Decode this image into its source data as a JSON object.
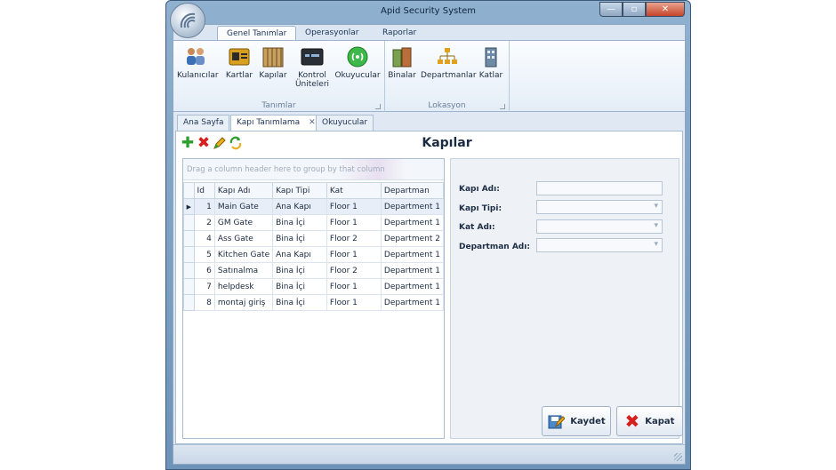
{
  "window": {
    "title": "Apid Security System",
    "min": "—",
    "max": "▫",
    "close": "✕"
  },
  "ribbon": {
    "tabs": [
      "Genel Tanımlar",
      "Operasyonlar",
      "Raporlar"
    ],
    "groups": [
      {
        "label": "Tanımlar",
        "buttons": [
          "Kulanıcılar",
          "Kartlar",
          "Kapılar",
          "Kontrol Üniteleri",
          "Okuyucular"
        ]
      },
      {
        "label": "Lokasyon",
        "buttons": [
          "Binalar",
          "Departmanlar",
          "Katlar"
        ]
      }
    ]
  },
  "doc_tabs": [
    "Ana Sayfa",
    "Kapı Tanımlama",
    "Okuyucular"
  ],
  "page": {
    "title": "Kapılar"
  },
  "grid": {
    "group_hint": "Drag a column header here to group by that column",
    "columns": [
      "Id",
      "Kapı Adı",
      "Kapı Tipi",
      "Kat",
      "Departman"
    ],
    "rows": [
      [
        "1",
        "Main Gate",
        "Ana Kapı",
        "Floor 1",
        "Department 1"
      ],
      [
        "2",
        "GM Gate",
        "Bina İçi",
        "Floor 1",
        "Department 1"
      ],
      [
        "4",
        "Ass Gate",
        "Bina İçi",
        "Floor 2",
        "Department 2"
      ],
      [
        "5",
        "Kitchen Gate",
        "Ana Kapı",
        "Floor 1",
        "Department 1"
      ],
      [
        "6",
        "Satınalma",
        "Bina İçi",
        "Floor 2",
        "Department 1"
      ],
      [
        "7",
        "helpdesk",
        "Bina İçi",
        "Floor 1",
        "Department 1"
      ],
      [
        "8",
        "montaj giriş",
        "Bina İçi",
        "Floor 1",
        "Department 1"
      ]
    ]
  },
  "form": {
    "labels": [
      "Kapı Adı:",
      "Kapı Tipi:",
      "Kat Adı:",
      "Departman Adı:"
    ],
    "save_label": "Kaydet",
    "close_label": "Kapat"
  }
}
